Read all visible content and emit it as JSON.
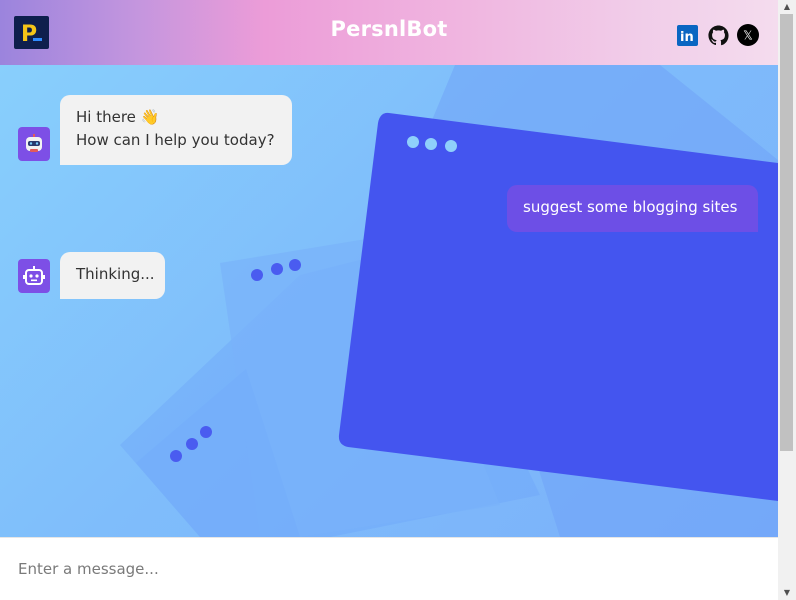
{
  "header": {
    "app_title": "PersnlBot",
    "logo_letter": "P",
    "social": [
      {
        "name": "linkedin",
        "glyph": "in"
      },
      {
        "name": "github"
      },
      {
        "name": "x",
        "glyph": "𝕏"
      }
    ]
  },
  "chat": {
    "messages": [
      {
        "role": "bot",
        "lines": [
          "Hi there 👋",
          "How can I help you today?"
        ]
      },
      {
        "role": "user",
        "text": "suggest some blogging sites"
      },
      {
        "role": "bot",
        "text": "Thinking..."
      }
    ]
  },
  "composer": {
    "placeholder": "Enter a message..."
  },
  "colors": {
    "accent": "#6d4fe6",
    "bot_bubble": "#f2f2f2",
    "chat_bg": "#85c5fb",
    "panel": "#4257f0"
  }
}
